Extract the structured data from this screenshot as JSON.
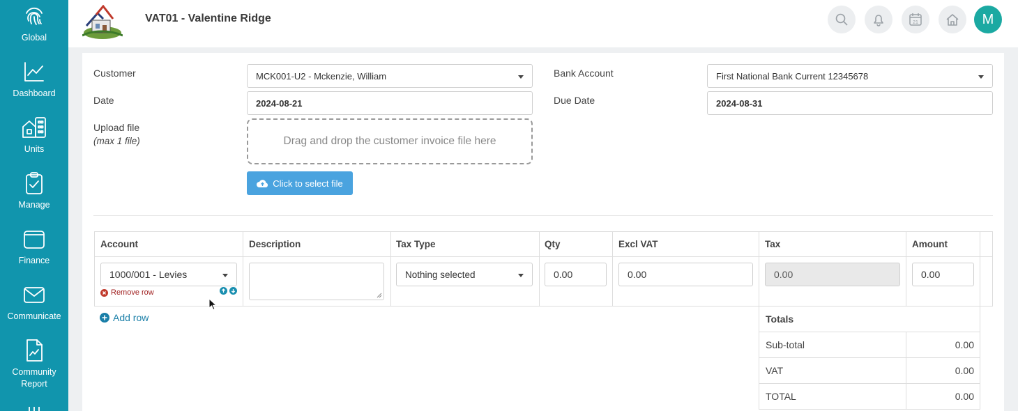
{
  "sidebar": {
    "items": [
      {
        "label": "Global",
        "icon": "fingerprint-icon"
      },
      {
        "label": "Dashboard",
        "icon": "chart-line-icon"
      },
      {
        "label": "Units",
        "icon": "building-icon"
      },
      {
        "label": "Manage",
        "icon": "clipboard-check-icon"
      },
      {
        "label": "Finance",
        "icon": "wallet-icon"
      },
      {
        "label": "Communicate",
        "icon": "envelope-icon"
      },
      {
        "label": "Community Report",
        "icon": "document-chart-icon"
      }
    ]
  },
  "header": {
    "title": "VAT01 - Valentine Ridge",
    "avatar_initial": "M",
    "icons": [
      "search-icon",
      "bell-icon",
      "calendar-icon",
      "home-icon"
    ],
    "calendar_day": "21"
  },
  "form": {
    "customer_label": "Customer",
    "customer_value": "MCK001-U2 - Mckenzie, William",
    "date_label": "Date",
    "date_value": "2024-08-21",
    "upload_label": "Upload file",
    "upload_sublabel": "(max 1 file)",
    "dropzone_text": "Drag and drop the customer invoice file here",
    "select_file_label": "Click to select file",
    "bank_label": "Bank Account",
    "bank_value": "First National Bank Current 12345678",
    "due_label": "Due Date",
    "due_value": "2024-08-31"
  },
  "table": {
    "headers": [
      "Account",
      "Description",
      "Tax Type",
      "Qty",
      "Excl VAT",
      "Tax",
      "Amount"
    ],
    "row": {
      "account": "1000/001 - Levies",
      "description": "",
      "tax_type": "Nothing selected",
      "qty": "0.00",
      "excl_vat": "0.00",
      "tax": "0.00",
      "amount": "0.00"
    },
    "remove_row_label": "Remove row",
    "add_row_label": "Add row"
  },
  "totals": {
    "title": "Totals",
    "rows": [
      {
        "label": "Sub-total",
        "value": "0.00"
      },
      {
        "label": "VAT",
        "value": "0.00"
      },
      {
        "label": "TOTAL",
        "value": "0.00"
      }
    ]
  },
  "colors": {
    "sidebar": "#1195ad",
    "accent": "#1ba9a2",
    "button": "#4aa3df",
    "danger": "#c0392b"
  }
}
